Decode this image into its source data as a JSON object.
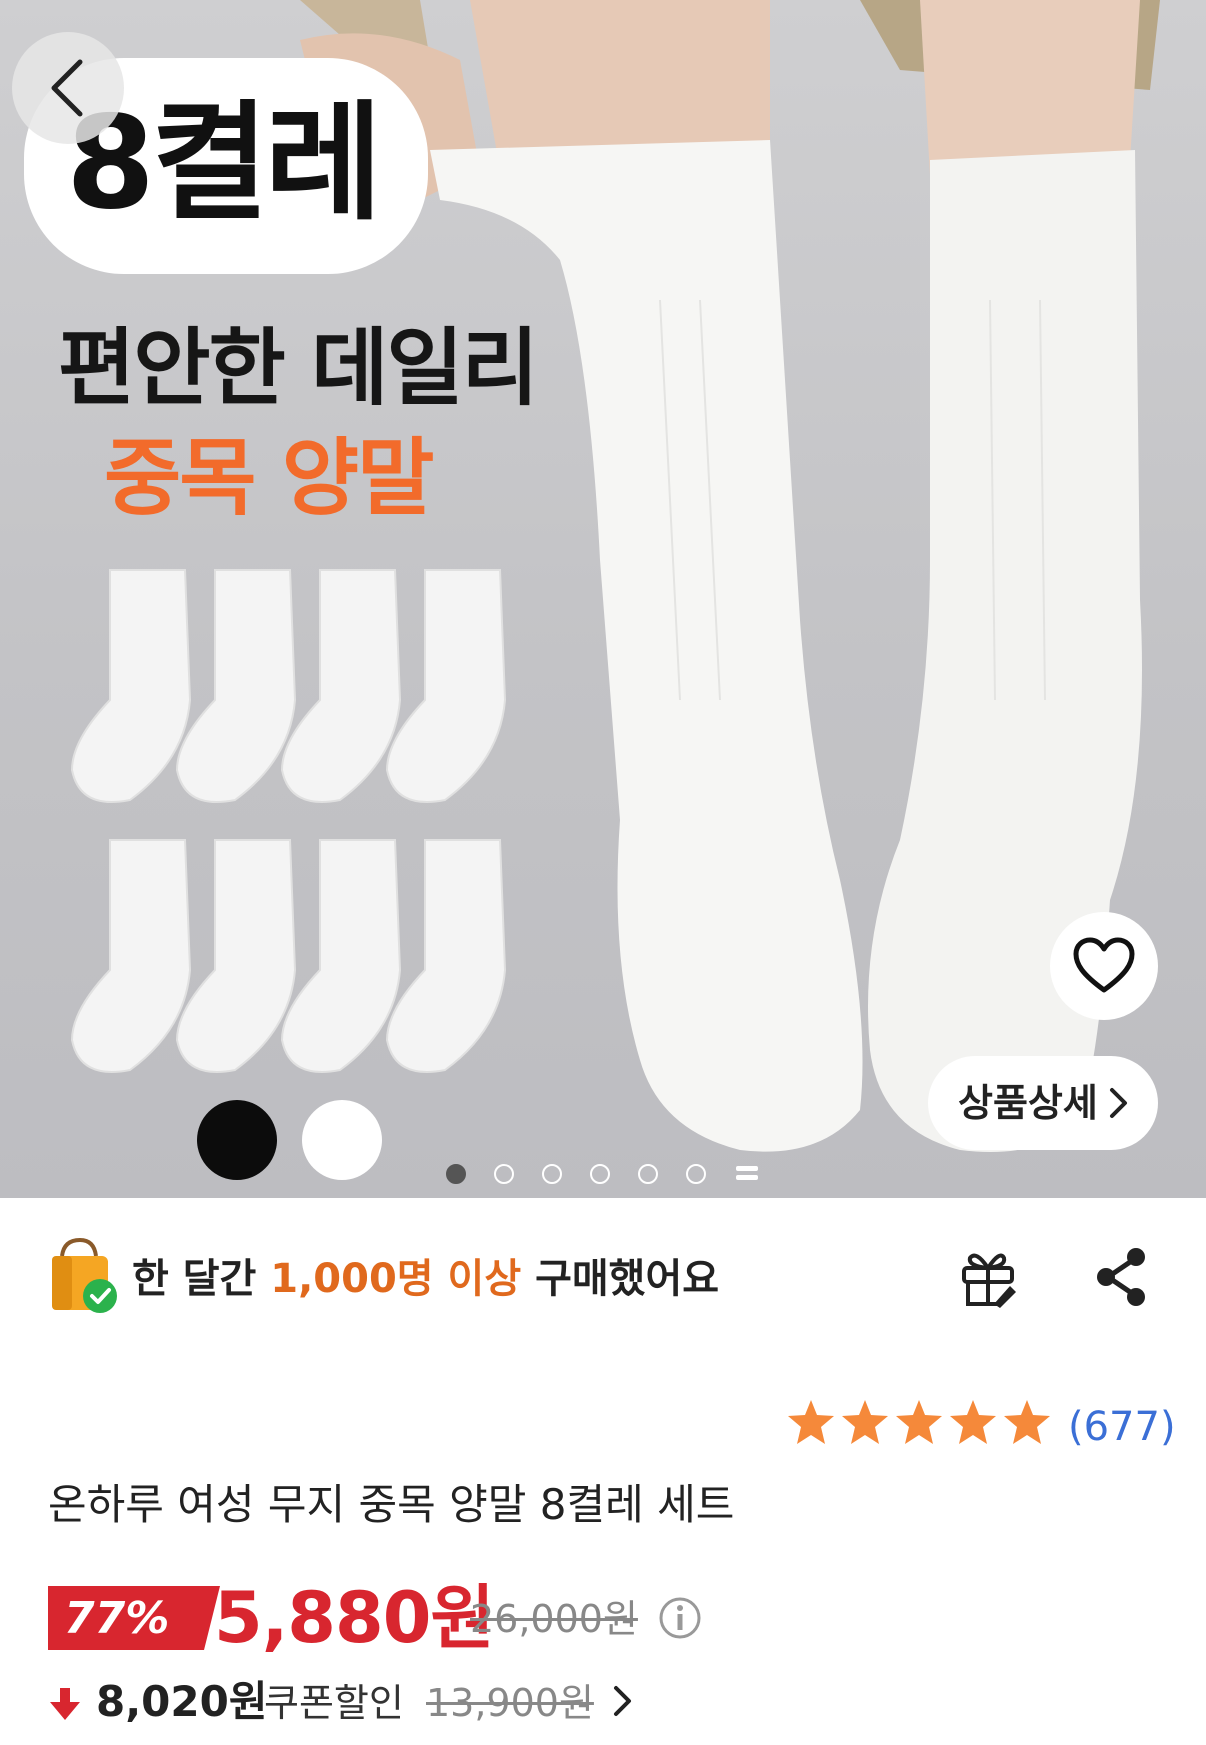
{
  "hero": {
    "badge": "8켤레",
    "headline_line1": "편안한 데일리",
    "headline_line2": "중목 양말",
    "color_swatches": [
      {
        "name": "black",
        "color": "#0c0c0c"
      },
      {
        "name": "white",
        "color": "#ffffff"
      }
    ],
    "carousel": {
      "total_dots": 6,
      "active_index": 0,
      "has_more": true
    },
    "detail_button": "상품상세",
    "icons": {
      "back": "back-chevron-icon",
      "wishlist": "heart-icon",
      "detail": "chevron-right-icon"
    }
  },
  "social_proof": {
    "prefix": "한 달간",
    "highlight": "1,000명 이상",
    "suffix": "구매했어요",
    "icons": {
      "bag": "shopping-bag-check-icon",
      "gift": "gift-icon",
      "share": "share-icon"
    }
  },
  "rating": {
    "stars": 5,
    "star_color": "#f5893a",
    "review_count": "(677)"
  },
  "product": {
    "title": "온하루 여성 무지 중목 양말 8켤레 세트"
  },
  "price": {
    "discount": "77%",
    "sale_price": "5,880원",
    "original_price": "26,000원",
    "accent_color": "#d8262f"
  },
  "coupon": {
    "price": "8,020원",
    "label": "쿠폰할인",
    "original": "13,900원"
  }
}
